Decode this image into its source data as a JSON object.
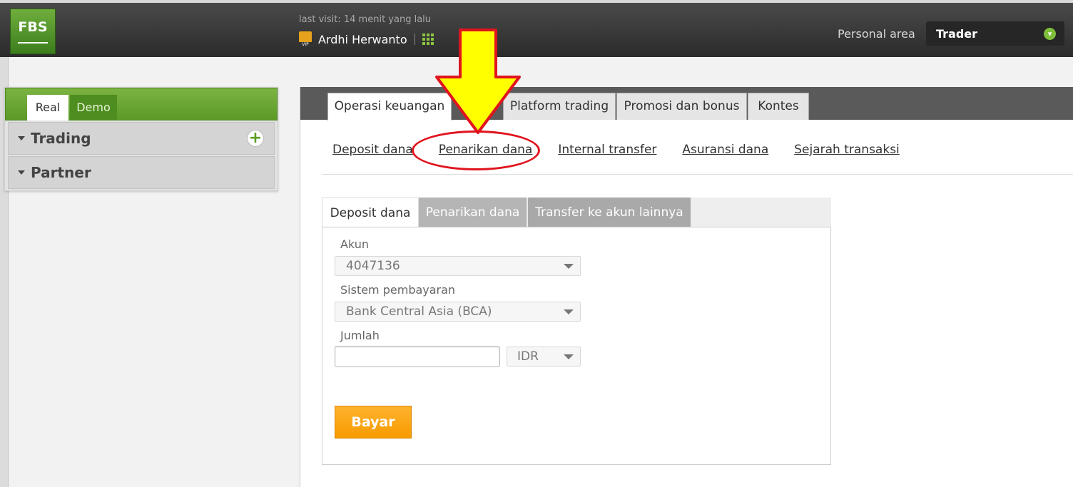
{
  "header": {
    "logo": "FBS",
    "last_visit": "last visit: 14 menit yang lalu",
    "user_name": "Ardhi Herwanto",
    "personal_area": "Personal area",
    "trader": "Trader"
  },
  "sidebar": {
    "account_tabs": [
      "Real",
      "Demo"
    ],
    "sections": [
      {
        "label": "Trading"
      },
      {
        "label": "Partner"
      }
    ]
  },
  "main_tabs": [
    {
      "label": "Operasi keuangan",
      "active": true
    },
    {
      "label": "Platform trading"
    },
    {
      "label": "Promosi dan bonus"
    },
    {
      "label": "Kontes"
    }
  ],
  "sub_links": [
    "Deposit dana",
    "Penarikan dana",
    "Internal transfer",
    "Asuransi dana",
    "Sejarah transaksi"
  ],
  "form": {
    "tabs": [
      "Deposit dana",
      "Penarikan dana",
      "Transfer ke akun lainnya"
    ],
    "account_label": "Akun",
    "account_value": "4047136",
    "payment_label": "Sistem pembayaran",
    "payment_value": "Bank Central Asia (BCA)",
    "amount_label": "Jumlah",
    "amount_value": "",
    "currency": "IDR",
    "pay_button": "Bayar"
  },
  "colors": {
    "brand_green": "#5b9a27",
    "pay_orange": "#f79b00",
    "arrow_yellow": "#ffff00",
    "annotation_red": "#e0141e"
  }
}
